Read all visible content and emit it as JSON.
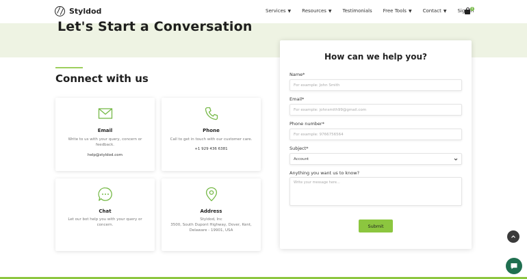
{
  "brand": {
    "name": "Styldod"
  },
  "nav": {
    "items": [
      {
        "label": "Services",
        "has_dropdown": true
      },
      {
        "label": "Resources",
        "has_dropdown": true
      },
      {
        "label": "Testimonials",
        "has_dropdown": false
      },
      {
        "label": "Free Tools",
        "has_dropdown": true
      },
      {
        "label": "Contact",
        "has_dropdown": true
      },
      {
        "label": "Sign in",
        "has_dropdown": false
      }
    ],
    "cart_count": "0"
  },
  "hero": {
    "title": "Let's Start a Conversation"
  },
  "connect": {
    "title": "Connect with us",
    "cards": [
      {
        "icon": "mail-icon",
        "title": "Email",
        "description": "Write to us with your query, concern or feedback.",
        "extra": "help@styldod.com"
      },
      {
        "icon": "phone-icon",
        "title": "Phone",
        "description": "Call to get in touch with our customer care.",
        "extra": "+1 929 436 6381"
      },
      {
        "icon": "chat-icon",
        "title": "Chat",
        "description": "Let our bot help you with your query or concern.",
        "extra": ""
      },
      {
        "icon": "location-pin-icon",
        "title": "Address",
        "description": "Styldod, Inc",
        "extra": "3500, South Dupont Highway, Dover, Kent, Delaware - 19901, USA"
      }
    ]
  },
  "form": {
    "title": "How can we help you?",
    "name_label": "Name*",
    "name_placeholder": "For example: John Smith",
    "email_label": "Email*",
    "email_placeholder": "For example: johnsmith99@gmail.com",
    "phone_label": "Phone number*",
    "phone_placeholder": "For example: 9766756564",
    "subject_label": "Subject*",
    "subject_value": "Account",
    "message_label": "Anything you want us to know?",
    "message_placeholder": "Write your message here...",
    "submit_label": "Submit"
  },
  "colors": {
    "accent": "#8cc63f",
    "hero_bg": "#eef3e3",
    "chat_bubble": "#1f6f50"
  }
}
